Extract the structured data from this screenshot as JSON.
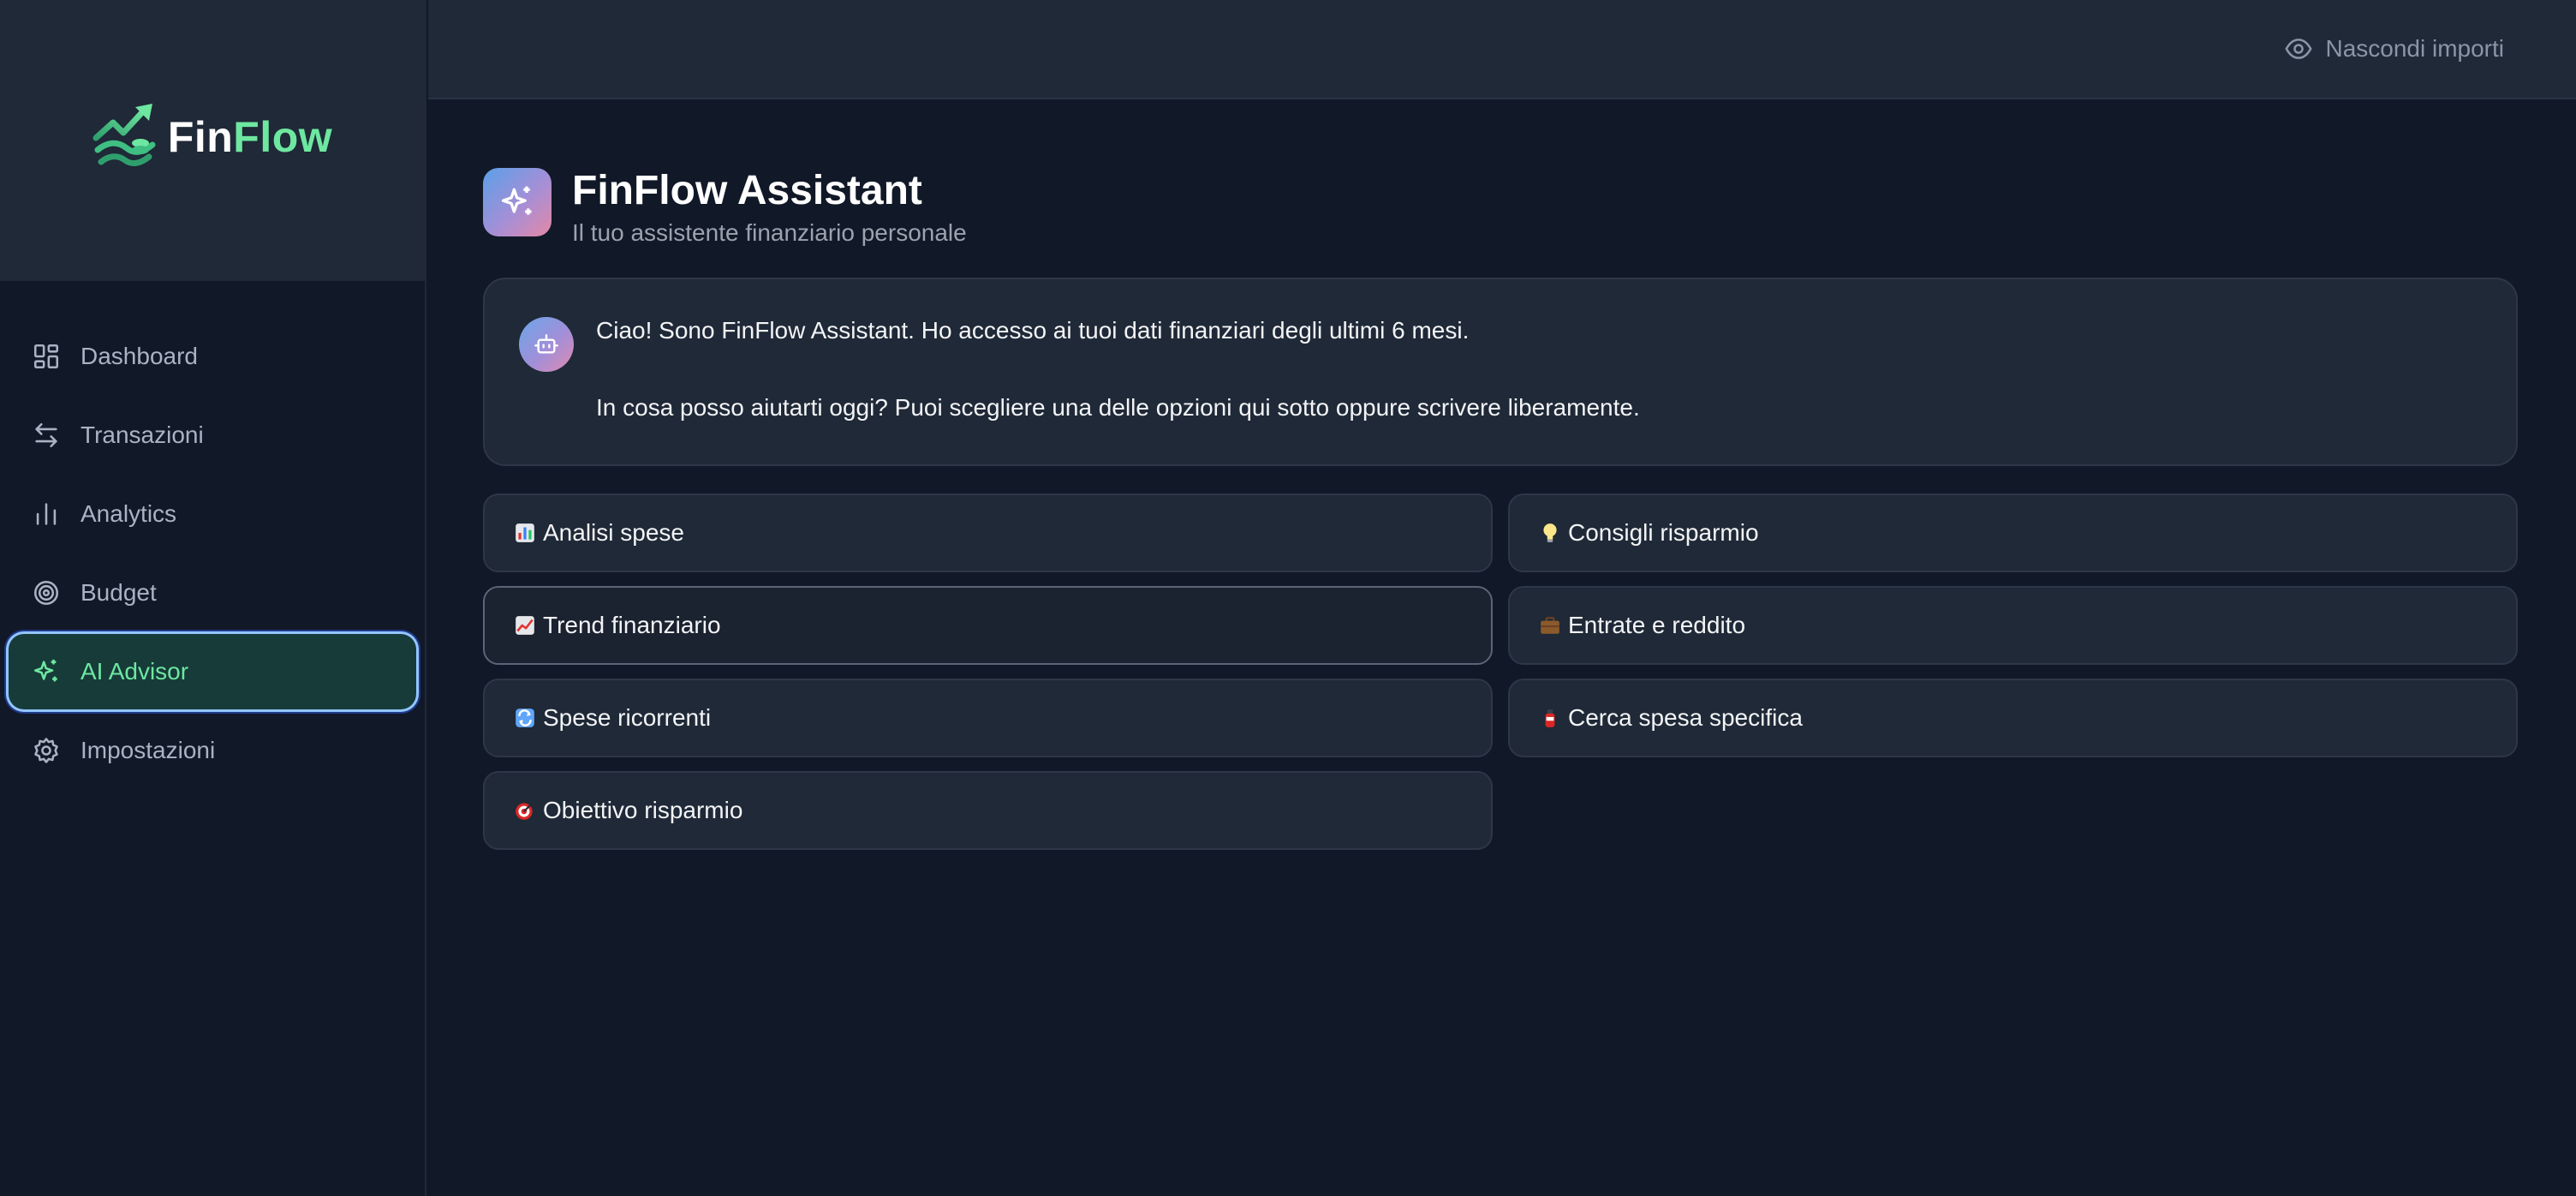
{
  "brand": {
    "name_part1": "Fin",
    "name_part2": "Flow"
  },
  "sidebar": {
    "items": [
      {
        "label": "Dashboard",
        "icon": "dashboard-icon"
      },
      {
        "label": "Transazioni",
        "icon": "arrows-exchange-icon"
      },
      {
        "label": "Analytics",
        "icon": "bar-chart-icon"
      },
      {
        "label": "Budget",
        "icon": "target-icon"
      },
      {
        "label": "AI Advisor",
        "icon": "sparkles-icon",
        "active": true
      },
      {
        "label": "Impostazioni",
        "icon": "gear-icon"
      }
    ]
  },
  "topbar": {
    "hide_amounts_label": "Nascondi importi",
    "icon": "eye-icon"
  },
  "header": {
    "title": "FinFlow Assistant",
    "subtitle": "Il tuo assistente finanziario personale"
  },
  "message": {
    "line1": "Ciao! Sono FinFlow Assistant. Ho accesso ai tuoi dati finanziari degli ultimi 6 mesi.",
    "line2": "In cosa posso aiutarti oggi? Puoi scegliere una delle opzioni qui sotto oppure scrivere liberamente."
  },
  "options": [
    {
      "label": "Analisi spese",
      "icon": "bar-chart-emoji"
    },
    {
      "label": "Consigli risparmio",
      "icon": "lightbulb-emoji"
    },
    {
      "label": "Trend finanziario",
      "icon": "chart-increasing-emoji"
    },
    {
      "label": "Entrate e reddito",
      "icon": "briefcase-emoji"
    },
    {
      "label": "Spese ricorrenti",
      "icon": "repeat-emoji"
    },
    {
      "label": "Cerca spesa specifica",
      "icon": "fire-extinguisher-emoji"
    },
    {
      "label": "Obiettivo risparmio",
      "icon": "dart-target-emoji"
    }
  ],
  "colors": {
    "accent_green": "#6ee7a0",
    "background": "#111827",
    "panel": "#1f2937",
    "focus_ring": "#93c5fd"
  }
}
